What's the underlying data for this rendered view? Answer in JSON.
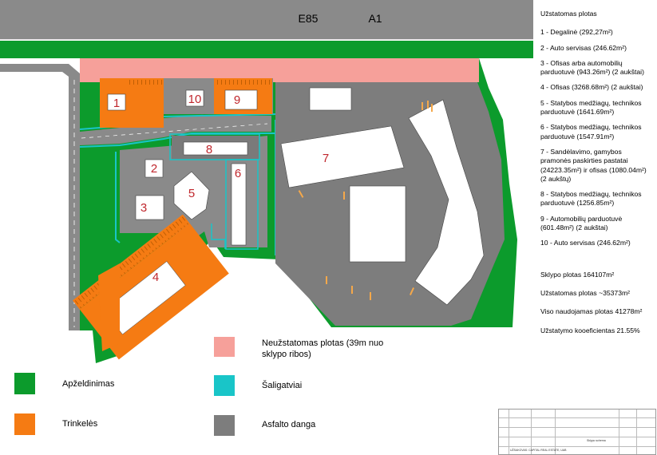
{
  "roads": {
    "e85": "E85",
    "a1": "A1"
  },
  "plots": [
    {
      "num": "1"
    },
    {
      "num": "2"
    },
    {
      "num": "3"
    },
    {
      "num": "4"
    },
    {
      "num": "5"
    },
    {
      "num": "6"
    },
    {
      "num": "7"
    },
    {
      "num": "8"
    },
    {
      "num": "9"
    },
    {
      "num": "10"
    }
  ],
  "notes": {
    "title": "Užstatomas plotas",
    "items": [
      "1 - Degalinė (292,27m²)",
      "2 - Auto servisas (246.62m²)",
      "3 - Ofisas arba automobilių parduotuvė (943.26m²) (2 aukštai)",
      "4 - Ofisas (3268.68m²) (2 aukštai)",
      "5 - Statybos medžiagų, technikos parduotuvė (1641.69m²)",
      "6 - Statybos medžiagų, technikos parduotuvė (1547.91m²)",
      "7 - Sandėlavimo, gamybos pramonės paskirties pastatai (24223.35m²) ir ofisas (1080.04m²) (2 aukštų)",
      "8 - Statybos medžiagų, technikos parduotuvė (1256.85m²)",
      "9 - Automobilių parduotuvė (601.48m²) (2 aukštai)",
      "10 - Auto servisas (246.62m²)"
    ],
    "summary": [
      "Sklypo plotas 164107m²",
      "Užstatomas plotas ~35373m²",
      "Viso naudojamas plotas 41278m²",
      "Užstatymo kooeficientas 21.55%"
    ]
  },
  "legend": {
    "greenery": {
      "label": "Apželdinimas",
      "color": "#0c9b2c"
    },
    "pavers": {
      "label": "Trinkelės",
      "color": "#f57b13"
    },
    "no_build": {
      "label_line1": "Neužstatomas plotas (39m nuo",
      "label_line2": "sklypo ribos)",
      "color": "#f6a09a"
    },
    "sidewalks": {
      "label": "Šaligatviai",
      "color": "#19c5c8"
    },
    "asphalt": {
      "label": "Asfalto danga",
      "color": "#7d7d7d"
    }
  },
  "title_block": {
    "row1": "Sklypo schema",
    "row2": "UŽSAKOVAS: CAPITAL REAL ESTATE, UAB"
  }
}
